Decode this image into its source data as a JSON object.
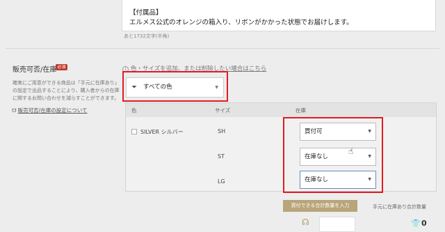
{
  "description_field": {
    "line1": "【付属品】",
    "line2": "エルメス公式のオレンジの箱入り、リボンがかかった状態でお届けします。",
    "char_count": "あと1732文字(半角)"
  },
  "stock_section": {
    "title": "販売可否/在庫",
    "required_badge": "必須",
    "desc_lines": [
      "確実にご用意ができる商品は「手元に在庫あり」",
      "の設定で出品することにより、購入者からの在庫",
      "に関するお問い合わせを減らすことができます。"
    ],
    "help_link": "販売可否/在庫の設定について",
    "add_color_link": "色・サイズを追加、または削除したい場合はこちら"
  },
  "color_filter": {
    "value": "すべての色"
  },
  "table": {
    "headers": {
      "color": "色",
      "size": "サイズ",
      "stock": "在庫"
    },
    "color_name": "SILVER シルバー",
    "rows": [
      {
        "size": "SH",
        "stock": "買付可"
      },
      {
        "size": "ST",
        "stock": "在庫なし"
      },
      {
        "size": "LG",
        "stock": "在庫なし"
      }
    ]
  },
  "totals": {
    "buyable_button": "買付できる合計数量を入力",
    "in_stock_label": "手元に在庫あり合計数量",
    "in_stock_total": "0"
  },
  "icons": {
    "filter": "filter-icon",
    "info": "info-icon",
    "dropdown": "chevron-down-icon",
    "cursor": "hand-pointer-icon"
  },
  "colors": {
    "highlight": "#e21b23",
    "gold": "#b9a57a",
    "required": "#c0392b"
  }
}
